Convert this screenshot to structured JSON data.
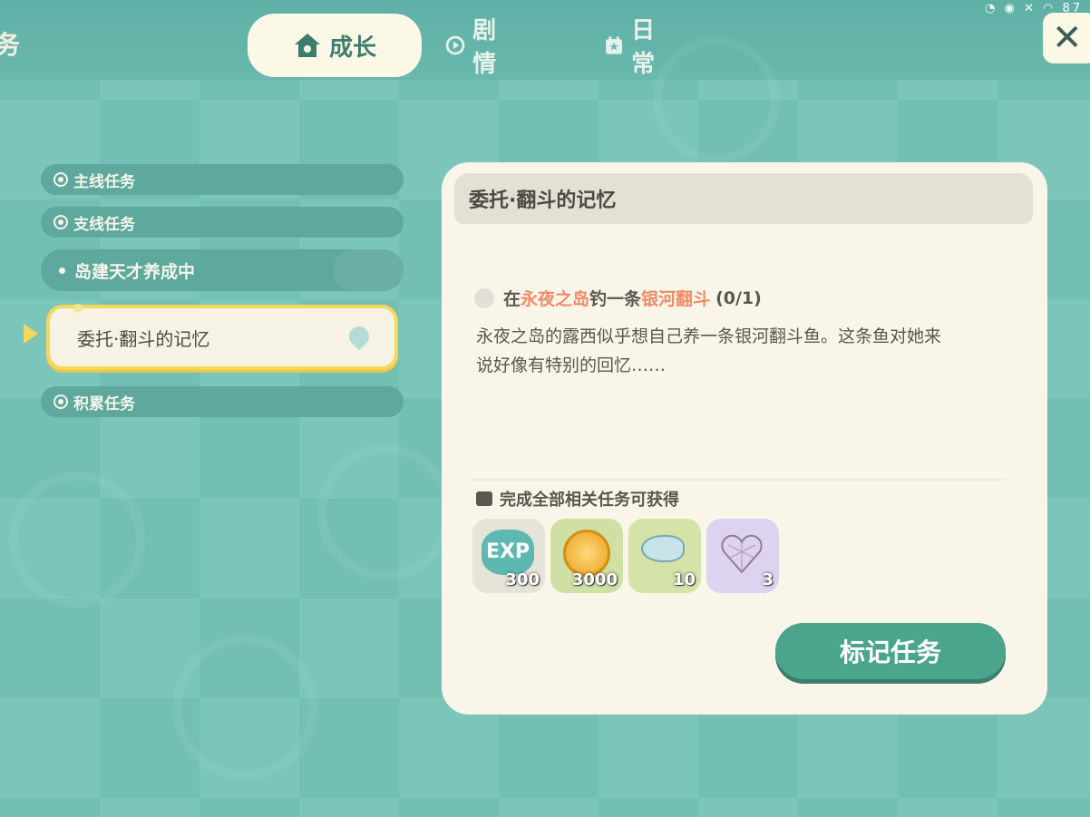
{
  "header": {
    "page_title_fragment": "务",
    "status_icons": "◔ ◉ ✕ ◠ 87",
    "tabs": [
      {
        "label": "成长",
        "icon": "house-icon",
        "active": true
      },
      {
        "label": "剧情",
        "icon": "play-icon",
        "active": false
      },
      {
        "label": "日常",
        "icon": "calendar-icon",
        "active": false
      }
    ],
    "close_icon": "close-icon"
  },
  "sidebar": {
    "categories": {
      "main": "主线任务",
      "side": "支线任务",
      "accumulate": "积累任务"
    },
    "quests": {
      "island": "岛建天才养成中",
      "selected": "委托·翻斗的记忆"
    }
  },
  "detail": {
    "title": "委托·翻斗的记忆",
    "objective": {
      "prefix": "在",
      "place": "永夜之岛",
      "middle": "钓一条",
      "target": "银河翻斗",
      "progress": "(0/1)"
    },
    "description_line1": "永夜之岛的露西似乎想自己养一条银河翻斗鱼。这条鱼对她来",
    "description_line2": "说好像有特别的回忆……",
    "reward_label": "完成全部相关任务可获得",
    "rewards": [
      {
        "icon": "exp-icon",
        "badge": "EXP",
        "count": "300"
      },
      {
        "icon": "coin-icon",
        "count": "3000"
      },
      {
        "icon": "fish-lure-icon",
        "count": "10"
      },
      {
        "icon": "heart-icon",
        "count": "3"
      }
    ],
    "mark_button": "标记任务"
  },
  "colors": {
    "accent_text": "#f28a67",
    "button": "#4aa58c",
    "selected_border": "#f5d75a"
  }
}
